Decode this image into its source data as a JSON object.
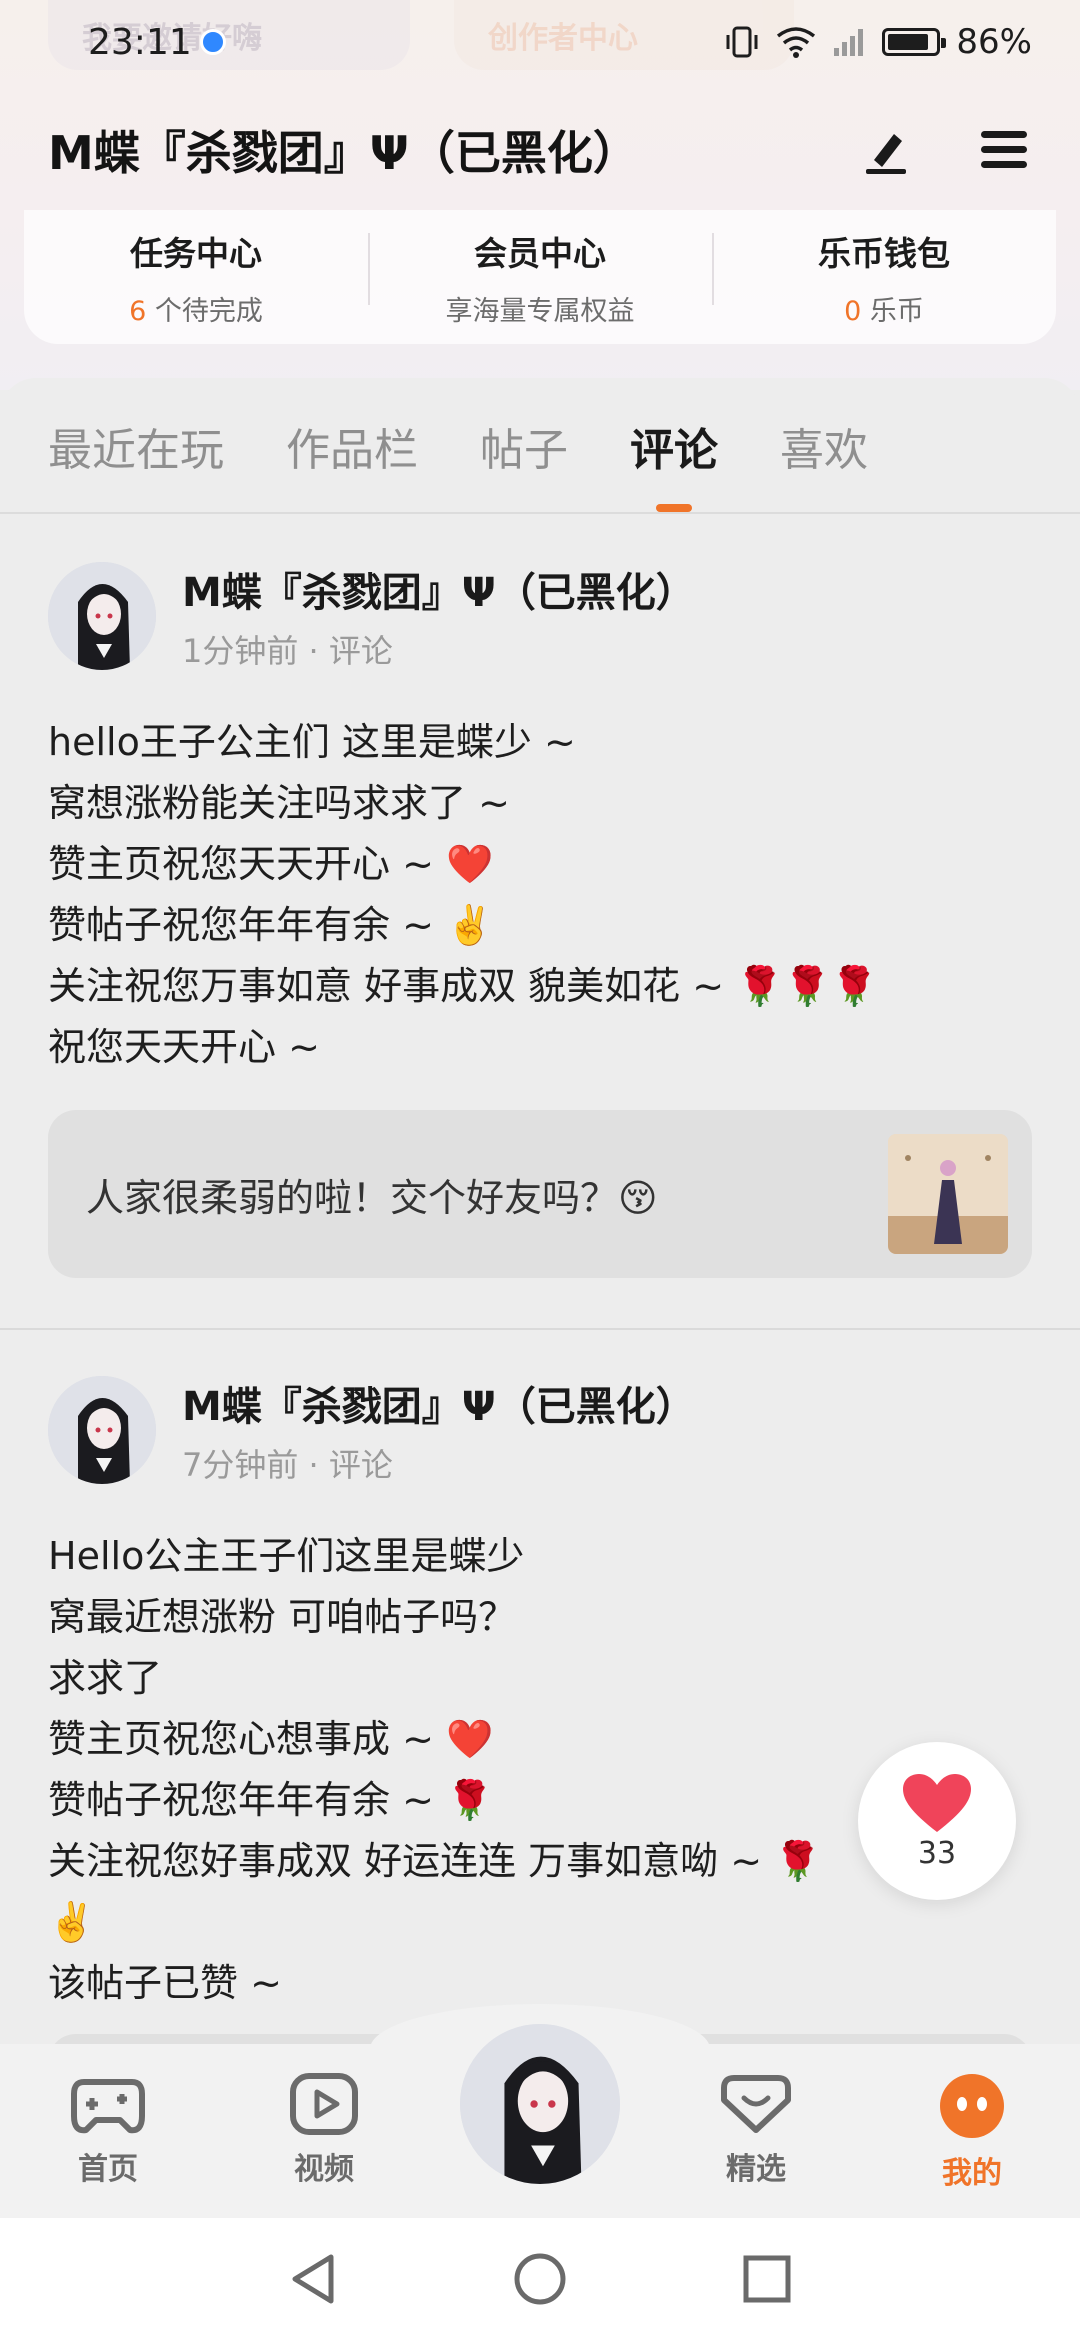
{
  "status_bar": {
    "time": "23:11",
    "battery": "86%"
  },
  "ghost_header": {
    "left_pill": "我要邀请好嗨",
    "right_pill": "创作者中心"
  },
  "header": {
    "title": "M蝶『杀戮团』Ψ（已黑化）"
  },
  "quick_links": [
    {
      "title": "任务中心",
      "count": "6",
      "sub": "个待完成"
    },
    {
      "title": "会员中心",
      "count": "",
      "sub": "享海量专属权益"
    },
    {
      "title": "乐币钱包",
      "count": "0",
      "sub": "乐币"
    }
  ],
  "tabs": [
    {
      "label": "最近在玩",
      "active": false
    },
    {
      "label": "作品栏",
      "active": false
    },
    {
      "label": "帖子",
      "active": false
    },
    {
      "label": "评论",
      "active": true
    },
    {
      "label": "喜欢",
      "active": false
    }
  ],
  "posts": [
    {
      "author": "M蝶『杀戮团』Ψ（已黑化）",
      "time": "1分钟前 · 评论",
      "body": "hello王子公主们 这里是蝶少 ~\n窝想涨粉能关注吗求求了 ~\n赞主页祝您天天开心 ~ ❤️\n赞帖子祝您年年有余 ~ ✌️\n关注祝您万事如意 好事成双 貌美如花 ~ 🌹🌹🌹\n祝您天天开心 ~",
      "quote": "人家很柔弱的啦！交个好友吗？😚"
    },
    {
      "author": "M蝶『杀戮团』Ψ（已黑化）",
      "time": "7分钟前 · 评论",
      "body": "Hello公主王子们这里是蝶少\n窝最近想涨粉 可咱帖子吗？\n求求了\n赞主页祝您心想事成 ~ ❤️\n赞帖子祝您年年有余 ~ 🌹\n关注祝您好事成双 好运连连 万事如意呦 ~ 🌹\n✌️\n该帖子已赞 ~",
      "quote": ""
    }
  ],
  "like_float": {
    "count": "33",
    "color": "#f0445a"
  },
  "bottom_nav": [
    {
      "label": "首页",
      "icon": "gamepad-icon",
      "active": false
    },
    {
      "label": "视频",
      "icon": "play-icon",
      "active": false
    },
    {
      "label": "精选",
      "icon": "heart-badge-icon",
      "active": false
    },
    {
      "label": "我的",
      "icon": "face-icon",
      "active": true
    }
  ],
  "colors": {
    "accent": "#f07429",
    "like": "#f0445a"
  }
}
